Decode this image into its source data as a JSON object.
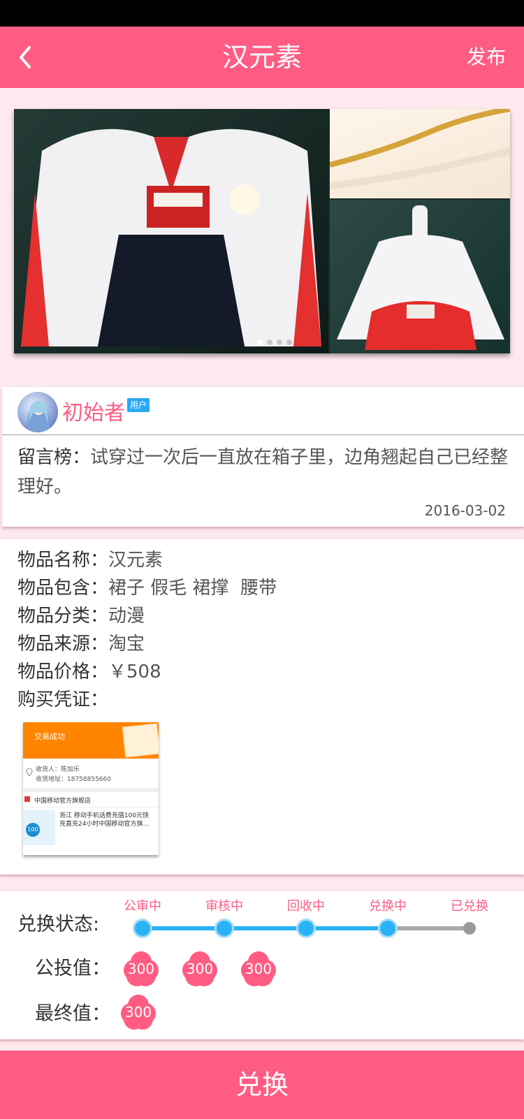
{
  "nav": {
    "title": "汉元素",
    "publish": "发布"
  },
  "gallery": {
    "page_count": 4,
    "active_page": 1
  },
  "user": {
    "name": "初始者",
    "badge": "用户",
    "message_label": "留言榜：",
    "message_text": "试穿过一次后一直放在箱子里，边角翘起自己已经整理好。",
    "date": "2016-03-02"
  },
  "item": {
    "name_label": "物品名称：",
    "name": "汉元素",
    "include_label": "物品包含：",
    "include": "裙子 假毛 裙撑  腰带",
    "category_label": "物品分类：",
    "category": "动漫",
    "source_label": "物品来源：",
    "source": "淘宝",
    "price_label": "物品价格：",
    "price": "￥508",
    "proof_label": "购买凭证："
  },
  "receipt": {
    "status": "交易成功",
    "receiver": "收货人：陈加乐",
    "address": "收货地址：18758855660",
    "shop": "中国移动官方旗舰店",
    "product": "浙江 移动手机话费充值100元快充直充24小时中国移动官方旗..."
  },
  "exchange": {
    "status_label": "兑换状态:",
    "stages": [
      "公审中",
      "审核中",
      "回收中",
      "兑换中",
      "已兑换"
    ],
    "current_stage_index": 3,
    "public_label": "公投值：",
    "public_values": [
      "300",
      "300",
      "300"
    ],
    "final_label": "最终值：",
    "final_value": "300"
  },
  "action": {
    "exchange_button": "兑换"
  },
  "colors": {
    "primary": "#ff5c84",
    "progress": "#29b3f4",
    "background": "#fde9ee"
  }
}
